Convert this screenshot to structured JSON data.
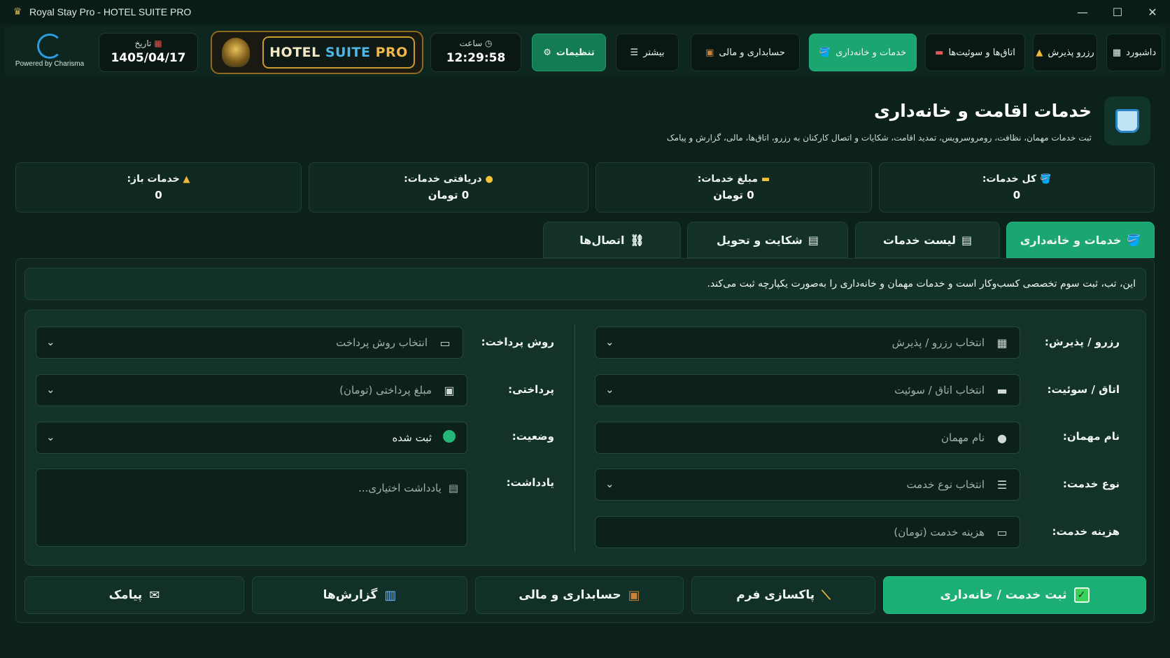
{
  "window": {
    "title": "Royal Stay Pro - HOTEL SUITE PRO",
    "minimize": "—",
    "maximize": "☐",
    "close": "✕"
  },
  "brand": {
    "powered_by": "Powered by Charisma"
  },
  "date": {
    "label": "تاریخ",
    "value": "1405/04/17"
  },
  "time": {
    "label": "ساعت",
    "value": "12:29:58"
  },
  "hotel_badge": {
    "part1": "HOTEL ",
    "part2": "SUITE ",
    "part3": "PRO"
  },
  "nav": {
    "settings": "تنظیمات",
    "more": "بیشتر",
    "accounting": "حسابداری و مالی",
    "services": "خدمات و خانه‌داری",
    "rooms": "اتاق‌ها و سوئیت‌ها",
    "reservation": "رزرو پذیرش",
    "dashboard": "داشبورد"
  },
  "header": {
    "title": "خدمات اقامت و خانه‌داری",
    "subtitle": "ثبت خدمات مهمان، نظافت، رومروسرویس، تمدید اقامت، شکایات و اتصال کارکنان به رزرو، اتاق‌ها، مالی، گزارش و پیامک"
  },
  "stats": {
    "total": {
      "label": "کل خدمات:",
      "value": "0"
    },
    "amount": {
      "label": "مبلغ خدمات:",
      "value": "0 تومان"
    },
    "received": {
      "label": "دریافتی خدمات:",
      "value": "0 تومان"
    },
    "open": {
      "label": "خدمات باز:",
      "value": "0"
    }
  },
  "tabs": {
    "services": "خدمات و خانه‌داری",
    "list": "لیست خدمات",
    "complaints": "شکایت و تحویل",
    "connections": "اتصال‌ها"
  },
  "info": "این، تب، ثبت سوم تخصصی کسب‌وکار است و خدمات مهمان و خانه‌داری را به‌صورت یکپارچه ثبت می‌کند.",
  "form": {
    "reservation": {
      "label": "رزرو / پذیرش:",
      "placeholder": "انتخاب رزرو / پذیرش"
    },
    "room": {
      "label": "اتاق / سوئیت:",
      "placeholder": "انتخاب اتاق / سوئیت"
    },
    "guest": {
      "label": "نام مهمان:",
      "placeholder": "نام مهمان"
    },
    "service_type": {
      "label": "نوع خدمت:",
      "placeholder": "انتخاب نوع خدمت"
    },
    "service_cost": {
      "label": "هزینه خدمت:",
      "placeholder": "هزینه خدمت (تومان)"
    },
    "payment_method": {
      "label": "روش پرداخت:",
      "placeholder": "انتخاب روش پرداخت"
    },
    "paid": {
      "label": "پرداختی:",
      "placeholder": "مبلغ پرداختی (تومان)"
    },
    "status": {
      "label": "وضعیت:",
      "value": "ثبت شده"
    },
    "note": {
      "label": "یادداشت:",
      "placeholder": "یادداشت اختیاری..."
    }
  },
  "actions": {
    "submit": "ثبت خدمت / خانه‌داری",
    "clear": "پاکسازی فرم",
    "accounting": "حسابداری و مالی",
    "reports": "گزارش‌ها",
    "sms": "پیامک"
  },
  "colors": {
    "accent": "#1aa571",
    "background": "#0b211a",
    "gold": "#c99a2e"
  }
}
